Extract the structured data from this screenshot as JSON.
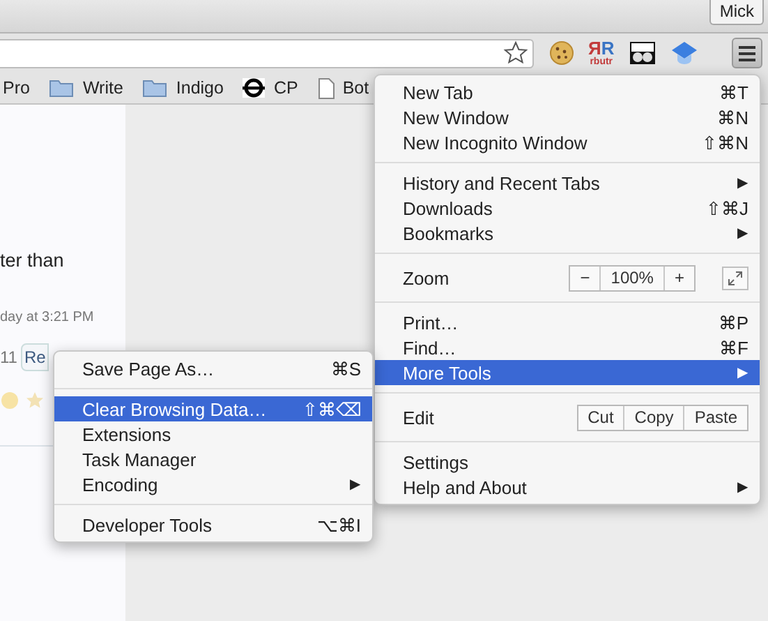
{
  "window": {
    "user": "Mick"
  },
  "extensions": [
    {
      "kind": "cookie"
    },
    {
      "kind": "rbutr",
      "letters": [
        "Я",
        "R"
      ],
      "caption": "rbutr"
    },
    {
      "kind": "glasses"
    },
    {
      "kind": "cap"
    }
  ],
  "bookmarks": [
    {
      "label": "Pro",
      "kind": "text"
    },
    {
      "label": "Write",
      "kind": "folder"
    },
    {
      "label": "Indigo",
      "kind": "folder"
    },
    {
      "label": "CP",
      "kind": "site"
    },
    {
      "label": "Bot",
      "kind": "page"
    }
  ],
  "page": {
    "lines": [
      "ter than",
      "day at 3:21 PM"
    ],
    "count": "11",
    "reply_button": "Re"
  },
  "main_menu": {
    "sections": [
      [
        {
          "kind": "item",
          "label": "New Tab",
          "shortcut": "⌘T",
          "selected": false
        },
        {
          "kind": "item",
          "label": "New Window",
          "shortcut": "⌘N",
          "selected": false
        },
        {
          "kind": "item",
          "label": "New Incognito Window",
          "shortcut": "⇧⌘N",
          "selected": false
        }
      ],
      [
        {
          "kind": "item",
          "label": "History and Recent Tabs",
          "arrow": "▶",
          "selected": false
        },
        {
          "kind": "item",
          "label": "Downloads",
          "shortcut": "⇧⌘J",
          "selected": false
        },
        {
          "kind": "item",
          "label": "Bookmarks",
          "arrow": "▶",
          "selected": false
        }
      ],
      [
        {
          "kind": "zoom",
          "label": "Zoom",
          "minus": "−",
          "level": "100%",
          "plus": "+",
          "selected": false
        }
      ],
      [
        {
          "kind": "item",
          "label": "Print…",
          "shortcut": "⌘P",
          "selected": false
        },
        {
          "kind": "item",
          "label": "Find…",
          "shortcut": "⌘F",
          "selected": false
        },
        {
          "kind": "item",
          "label": "More Tools",
          "arrow": "▶",
          "selected": true
        }
      ],
      [
        {
          "kind": "edit",
          "label": "Edit",
          "buttons": [
            "Cut",
            "Copy",
            "Paste"
          ],
          "selected": false
        }
      ],
      [
        {
          "kind": "item",
          "label": "Settings",
          "selected": false
        },
        {
          "kind": "item",
          "label": "Help and About",
          "arrow": "▶",
          "selected": false
        }
      ]
    ]
  },
  "more_tools_menu": {
    "sections": [
      [
        {
          "kind": "item",
          "label": "Save Page As…",
          "shortcut": "⌘S",
          "selected": false
        }
      ],
      [
        {
          "kind": "item",
          "label": "Clear Browsing Data…",
          "shortcut": "⇧⌘⌫",
          "selected": true
        },
        {
          "kind": "item",
          "label": "Extensions",
          "selected": false
        },
        {
          "kind": "item",
          "label": "Task Manager",
          "selected": false
        },
        {
          "kind": "item",
          "label": "Encoding",
          "arrow": "▶",
          "selected": false
        }
      ],
      [
        {
          "kind": "item",
          "label": "Developer Tools",
          "shortcut": "⌥⌘I",
          "selected": false
        }
      ]
    ]
  }
}
